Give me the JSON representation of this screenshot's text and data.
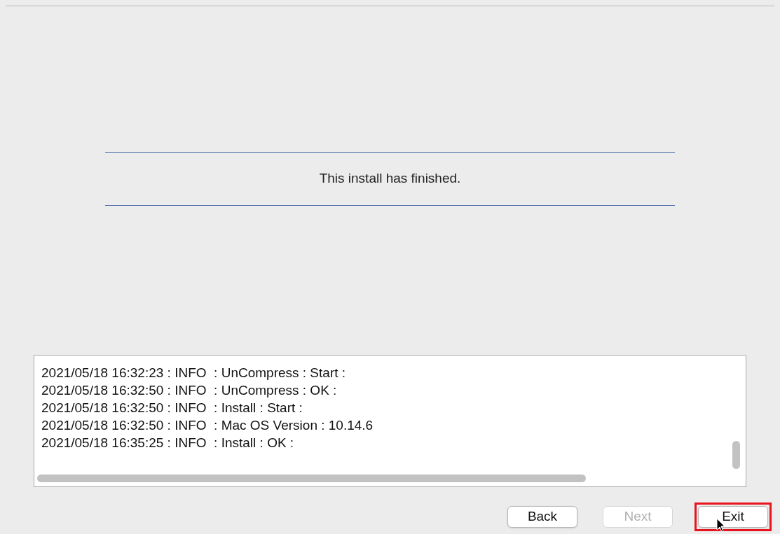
{
  "message": "This install has finished.",
  "log": {
    "lines": [
      "2021/05/18 16:32:23 : INFO  : UnCompress : Start :",
      "2021/05/18 16:32:50 : INFO  : UnCompress : OK :",
      "2021/05/18 16:32:50 : INFO  : Install : Start :",
      "2021/05/18 16:32:50 : INFO  : Mac OS Version : 10.14.6",
      "2021/05/18 16:35:25 : INFO  : Install : OK :"
    ]
  },
  "buttons": [
    {
      "label": "Back",
      "disabled": false,
      "highlighted": false
    },
    {
      "label": "Next",
      "disabled": true,
      "highlighted": false
    },
    {
      "label": "Exit",
      "disabled": false,
      "highlighted": true
    }
  ]
}
